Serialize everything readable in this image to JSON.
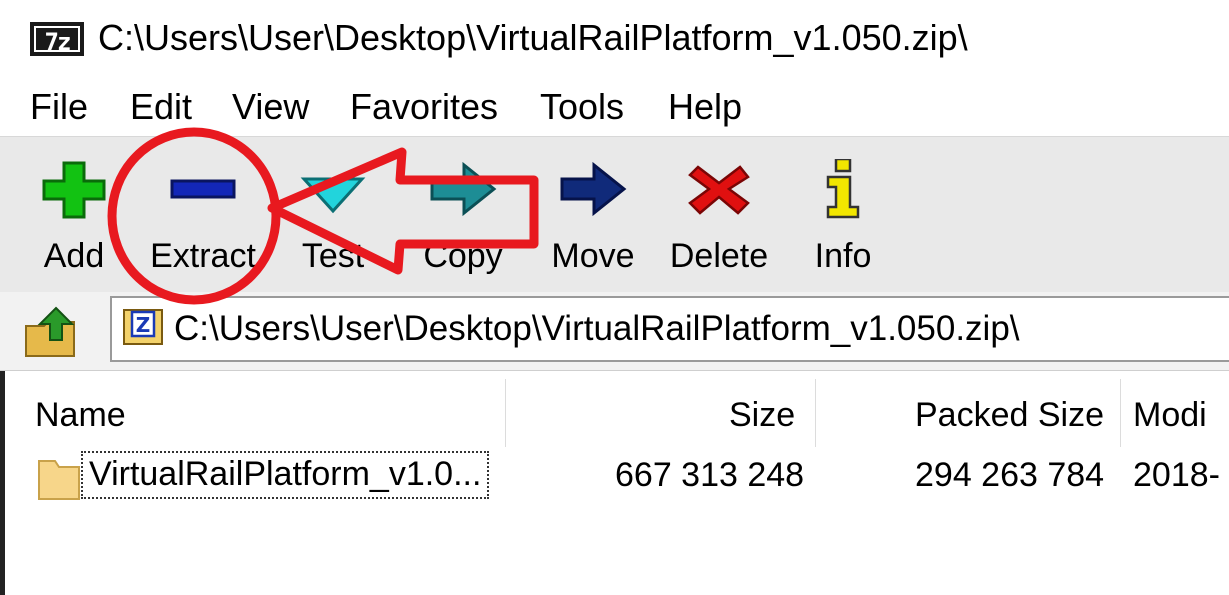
{
  "window": {
    "app_icon": "7z",
    "title": "C:\\Users\\User\\Desktop\\VirtualRailPlatform_v1.050.zip\\"
  },
  "menu": [
    "File",
    "Edit",
    "View",
    "Favorites",
    "Tools",
    "Help"
  ],
  "toolbar": {
    "add": "Add",
    "extract": "Extract",
    "test": "Test",
    "copy": "Copy",
    "move": "Move",
    "delete": "Delete",
    "info": "Info"
  },
  "address": {
    "path": "C:\\Users\\User\\Desktop\\VirtualRailPlatform_v1.050.zip\\"
  },
  "filelist": {
    "columns": [
      "Name",
      "Size",
      "Packed Size",
      "Modi"
    ],
    "rows": [
      {
        "name": "VirtualRailPlatform_v1.0...",
        "size": "667 313 248",
        "packed": "294 263 784",
        "modified": "2018-"
      }
    ]
  },
  "colors": {
    "annotation": "#e8191f",
    "add_plus": "#12c212",
    "extract_minus": "#1327b8",
    "delete_x": "#e01010",
    "info_i": "#f2e600",
    "toolbar_bg": "#e9e9e9"
  },
  "icons": {
    "add": "green-plus-icon",
    "extract": "blue-minus-icon",
    "test": "cyan-down-arrow-icon",
    "copy": "teal-right-arrow-icon",
    "move": "navy-right-arrow-icon",
    "delete": "red-x-icon",
    "info": "yellow-i-icon",
    "up": "folder-up-icon",
    "address": "zip-archive-icon",
    "row": "folder-icon"
  }
}
